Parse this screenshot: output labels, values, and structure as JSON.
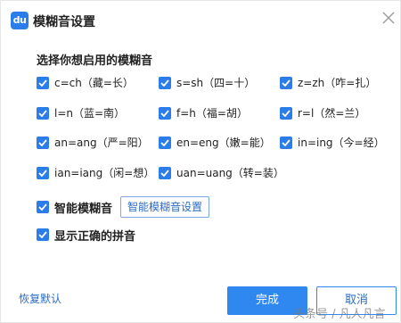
{
  "window": {
    "logo_text": "du",
    "title": "模糊音设置",
    "close_icon": "close-icon"
  },
  "section": {
    "title": "选择你想启用的模糊音"
  },
  "options": [
    {
      "label": "c=ch（藏=长）",
      "checked": true
    },
    {
      "label": "s=sh（四=十）",
      "checked": true
    },
    {
      "label": "z=zh（咋=扎）",
      "checked": true
    },
    {
      "label": "l=n（蓝=南）",
      "checked": true
    },
    {
      "label": "f=h（福=胡）",
      "checked": true
    },
    {
      "label": "r=l（然=兰）",
      "checked": true
    },
    {
      "label": "an=ang（严=阳）",
      "checked": true
    },
    {
      "label": "en=eng（嫩=能）",
      "checked": true
    },
    {
      "label": "in=ing（今=经）",
      "checked": true
    },
    {
      "label": "ian=iang（闲=想）",
      "checked": true
    },
    {
      "label": "uan=uang（转=装）",
      "checked": true
    }
  ],
  "smart": {
    "label": "智能模糊音",
    "checked": true,
    "settings_button": "智能模糊音设置"
  },
  "show_pinyin": {
    "label": "显示正确的拼音",
    "checked": true
  },
  "footer": {
    "restore_label": "恢复默认",
    "ok_label": "完成",
    "cancel_label": "取消"
  },
  "watermark": "头条号 / 凡人凡言",
  "colors": {
    "accent": "#2f88f0",
    "checkbox": "#2b7de9",
    "link": "#2b6cc4"
  }
}
